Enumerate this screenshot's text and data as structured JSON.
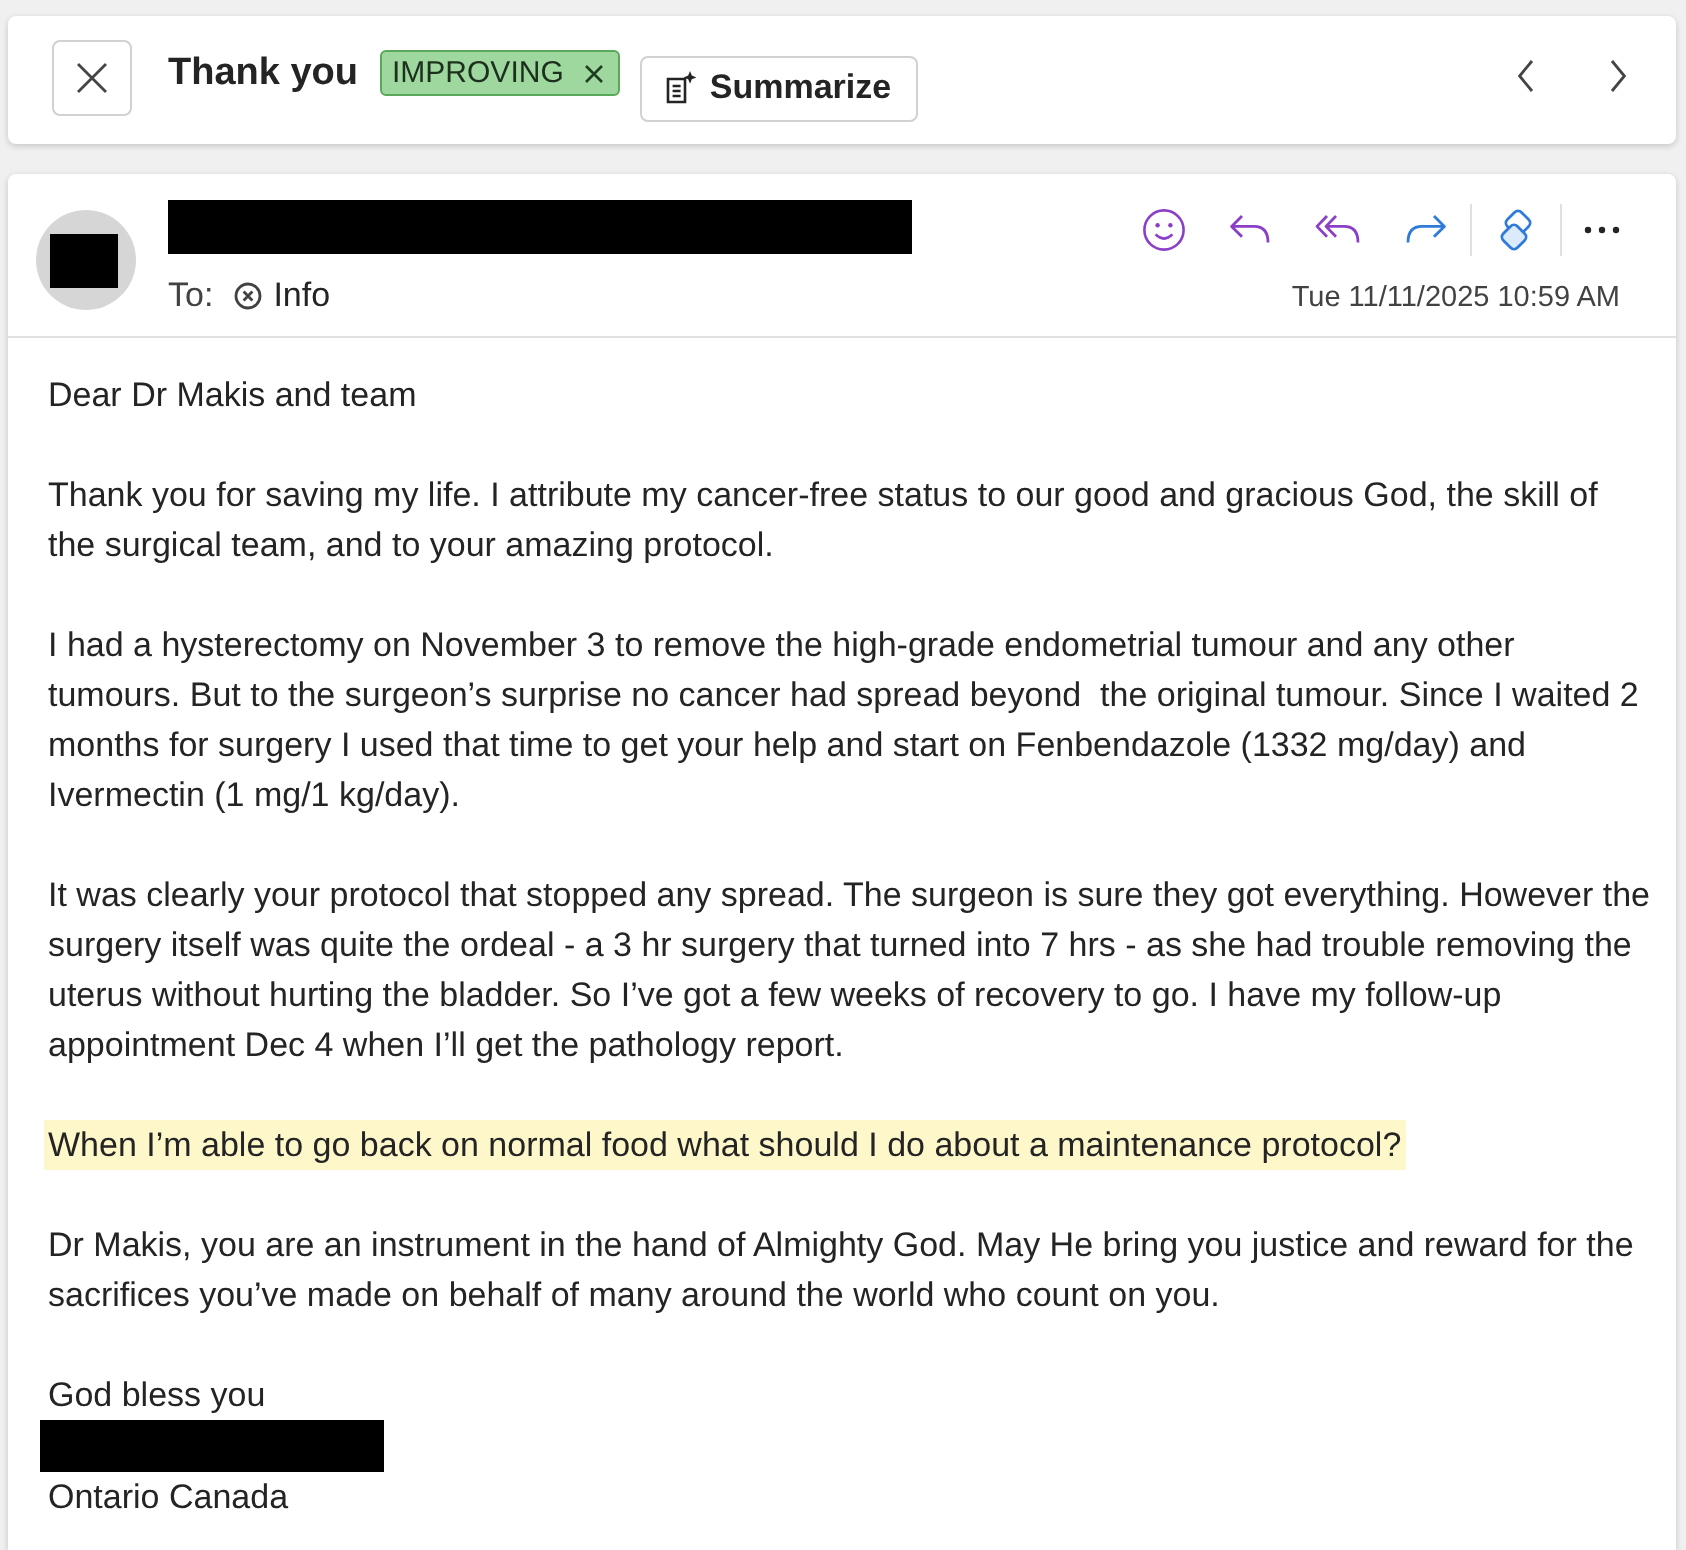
{
  "conversation": {
    "subject": "Thank you",
    "tags": [
      {
        "label": "IMPROVING",
        "color": "#9fd89f"
      }
    ],
    "summarize_button": "Summarize"
  },
  "message": {
    "to_label": "To:",
    "recipients": [
      "Info"
    ],
    "date": "Tue 11/11/2025 10:59 AM",
    "paragraphs": [
      {
        "text": "Dear Dr Makis and team",
        "highlighted": false
      },
      {
        "text": "Thank you for saving my life. I attribute my cancer-free status to our good and gracious God, the skill of the surgical team, and to your amazing protocol.",
        "highlighted": false
      },
      {
        "text": "I had a hysterectomy on November 3 to remove the high-grade endometrial tumour and any other tumours. But to the surgeon’s surprise no cancer had spread beyond  the original tumour. Since I waited 2 months for surgery I used that time to get your help and start on Fenbendazole (1332 mg/day) and Ivermectin (1 mg/1 kg/day).",
        "highlighted": false
      },
      {
        "text": "It was clearly your protocol that stopped any spread. The surgeon is sure they got everything. However the surgery itself was quite the ordeal - a 3 hr surgery that turned into 7 hrs - as she had trouble removing the uterus without hurting the bladder. So I’ve got a few weeks of recovery to go. I have my follow-up appointment Dec 4 when I’ll get the pathology report.",
        "highlighted": false
      },
      {
        "text": "When I’m able to go back on normal food what should I do about a maintenance protocol?",
        "highlighted": true
      },
      {
        "text": "Dr Makis, you are an instrument in the hand of Almighty God. May He bring you justice and reward for the sacrifices you’ve made on behalf of many around the world who count on you.",
        "highlighted": false
      }
    ],
    "signature": [
      {
        "kind": "text",
        "text": "God bless you"
      },
      {
        "kind": "redacted"
      },
      {
        "kind": "text",
        "text": "Ontario Canada"
      }
    ]
  }
}
